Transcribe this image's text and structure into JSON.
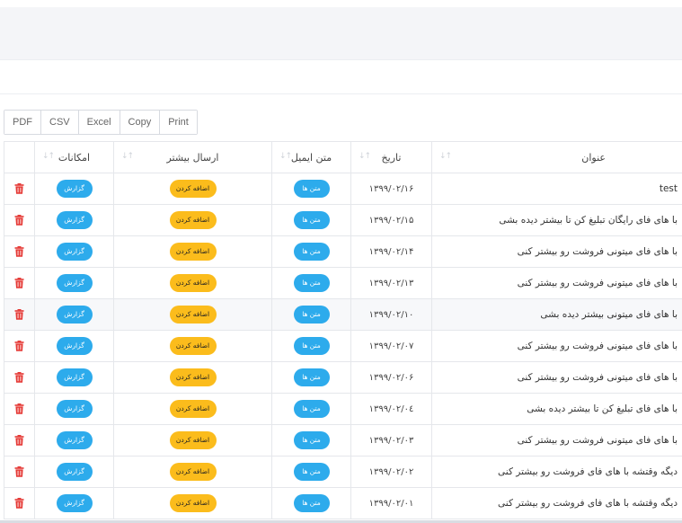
{
  "export": [
    "PDF",
    "CSV",
    "Excel",
    "Copy",
    "Print"
  ],
  "table": {
    "headers": {
      "title": "عنوان",
      "date": "تاریخ",
      "email_text": "متن ایمیل",
      "send_more": "ارسال بیشتر",
      "options": "امکانات"
    },
    "buttons": {
      "email_texts": "متن ها",
      "add": "اضافه کردن",
      "report": "گزارش"
    },
    "colors": {
      "blue": "#2dabec",
      "yellow": "#fbbc1c",
      "delete": "#e53935"
    },
    "rows": [
      {
        "title": "test",
        "date": "۱۳۹۹/۰۲/۱۶"
      },
      {
        "title": "با های فای رایگان تبلیغ کن تا بیشتر دیده بشی",
        "date": "۱۳۹۹/۰۲/۱۵"
      },
      {
        "title": "با های فای میتونی فروشت رو بیشتر کنی",
        "date": "۱۳۹۹/۰۲/۱۴"
      },
      {
        "title": "با های فای میتونی فروشت رو بیشتر کنی",
        "date": "۱۳۹۹/۰۲/۱۳"
      },
      {
        "title": "با های فای میتونی بیشتر دیده بشی",
        "date": "۱۳۹۹/۰۲/۱۰"
      },
      {
        "title": "با های فای میتونی فروشت رو بیشتر کنی",
        "date": "۱۳۹۹/۰۲/۰۷"
      },
      {
        "title": "با های فای میتونی فروشت رو بیشتر کنی",
        "date": "۱۳۹۹/۰۲/۰۶"
      },
      {
        "title": "با های فای تبلیغ کن تا بیشتر دیده بشی",
        "date": "۱۳۹۹/۰۲/۰٤"
      },
      {
        "title": "با های فای میتونی فروشت رو بیشتر کنی",
        "date": "۱۳۹۹/۰۲/۰۳"
      },
      {
        "title": "دیگه وقتشه با های فای فروشت رو بیشتر کنی",
        "date": "۱۳۹۹/۰۲/۰۲"
      },
      {
        "title": "دیگه وقتشه با های فای فروشت رو بیشتر کنی",
        "date": "۱۳۹۹/۰۲/۰۱"
      }
    ]
  }
}
